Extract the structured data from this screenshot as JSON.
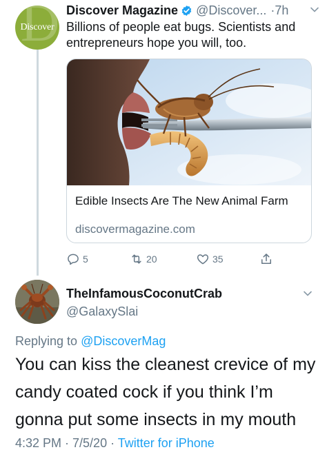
{
  "parent_tweet": {
    "avatar_text": "Discover",
    "display_name": "Discover Magazine",
    "verified": true,
    "handle": "@Discover...",
    "time": "·7h",
    "text": "Billions of people eat bugs. Scientists and entrepreneurs hope you will, too.",
    "card": {
      "image_icon": "cricket-and-larva-on-fork-image",
      "title": "Edible Insects Are The New Animal Farm",
      "domain": "discovermagazine.com"
    },
    "actions": {
      "replies": "5",
      "retweets": "20",
      "likes": "35"
    }
  },
  "reply_tweet": {
    "display_name": "TheInfamousCoconutCrab",
    "handle": "@GalaxySlai",
    "replying_prefix": "Replying to",
    "replying_mention": "@DiscoverMag",
    "text": "You can kiss the cleanest crevice of my candy coated cock if you think I’m gonna put some insects in my mouth",
    "timestamp": "4:32 PM · 7/5/20 · ",
    "source": "Twitter for iPhone"
  },
  "colors": {
    "link": "#1da1f2",
    "secondary_text": "#657786",
    "primary_text": "#14171a",
    "discover_green": "#8cad3a"
  }
}
